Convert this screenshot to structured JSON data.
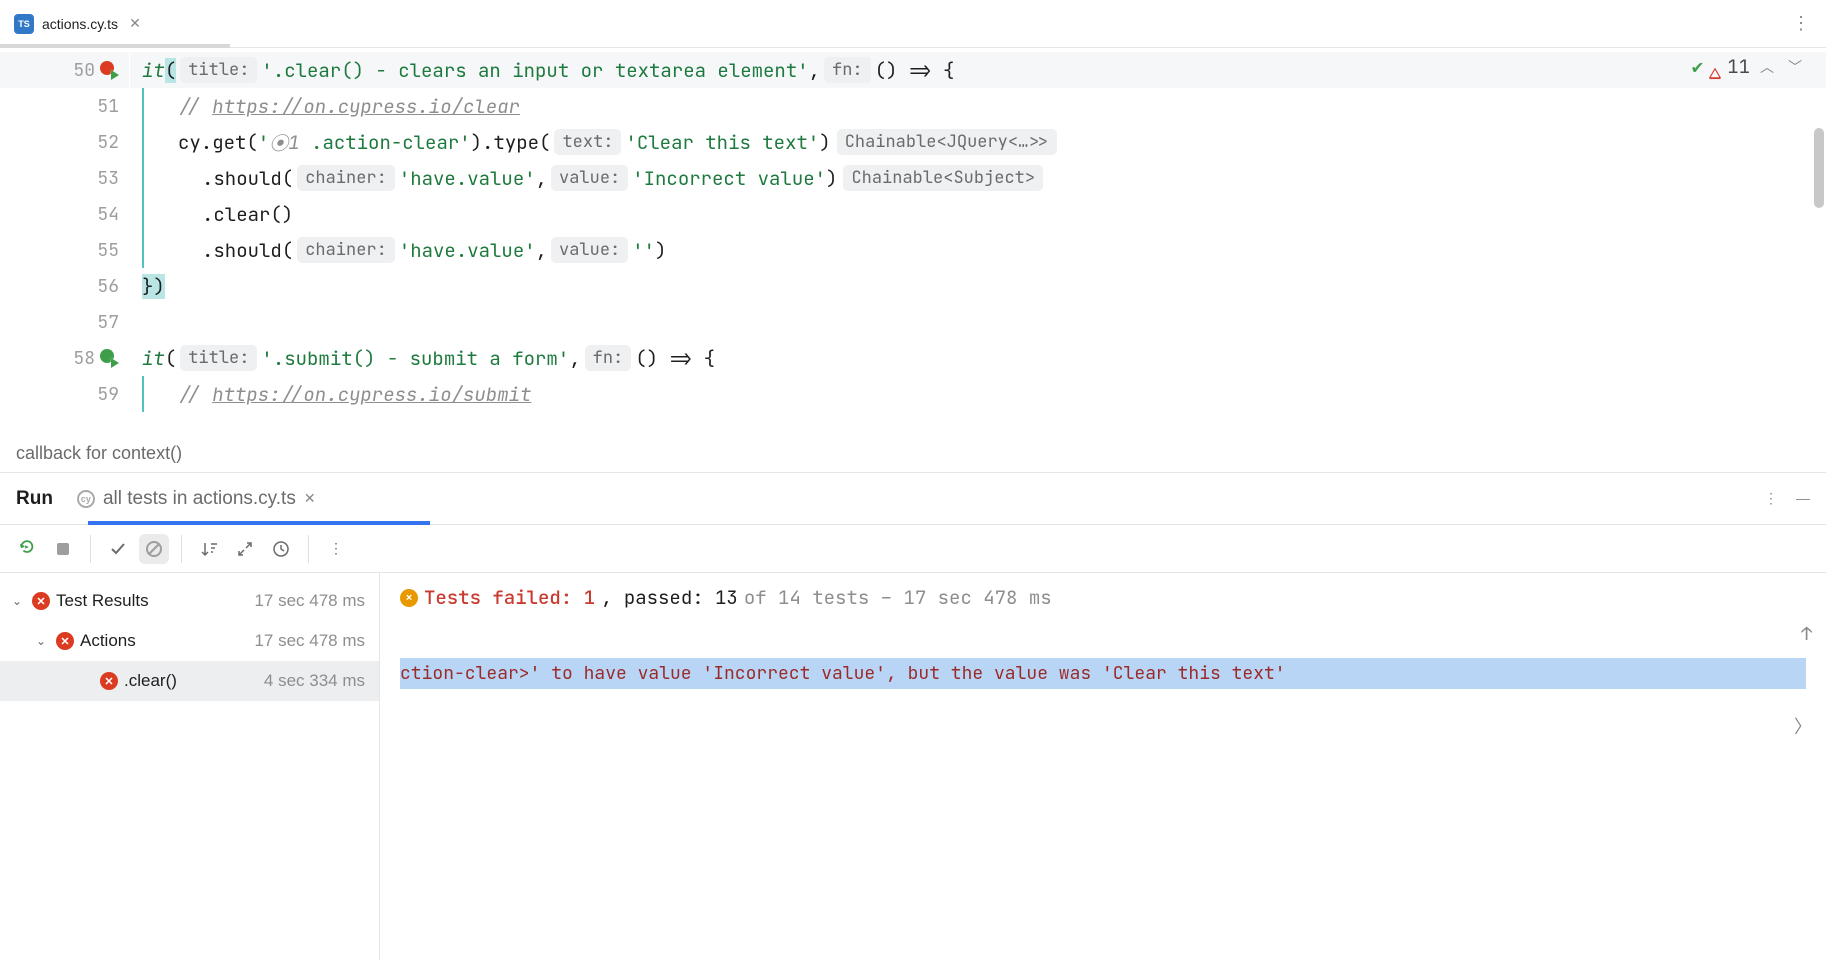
{
  "tab": {
    "filename": "actions.cy.ts"
  },
  "inspection": {
    "count": "11"
  },
  "code": {
    "line50": {
      "fn": "it",
      "title_hint": "title:",
      "title": "'.clear() - clears an input or textarea element'",
      "fn_hint": "fn:",
      "arrow": "() => {"
    },
    "line51": {
      "comment": "// ",
      "url": "https://on.cypress.io/clear"
    },
    "line52": {
      "pre": "cy.get(",
      "loc_icon": "⦿",
      "loc_num": "1",
      "sel": " .action-clear'",
      "mid": ").type(",
      "text_hint": "text:",
      "text": "'Clear this text'",
      "end": ")",
      "type_hint": "Chainable<JQuery<…>>"
    },
    "line53": {
      "pre": ".should(",
      "ch_hint": "chainer:",
      "ch": "'have.value'",
      "c": ",",
      "val_hint": "value:",
      "val": "'Incorrect value'",
      "end": ")",
      "type_hint": "Chainable<Subject>"
    },
    "line54": {
      "text": ".clear()"
    },
    "line55": {
      "pre": ".should(",
      "ch_hint": "chainer:",
      "ch": "'have.value'",
      "c": ",",
      "val_hint": "value:",
      "val": "''",
      "end": ")"
    },
    "line56": {
      "close": "})"
    },
    "line58": {
      "fn": "it",
      "title_hint": "title:",
      "title": "'.submit() - submit a form'",
      "fn_hint": "fn:",
      "arrow": "() => {"
    },
    "line59": {
      "comment": "// ",
      "url": "https://on.cypress.io/submit"
    }
  },
  "lines": [
    "50",
    "51",
    "52",
    "53",
    "54",
    "55",
    "56",
    "57",
    "58",
    "59"
  ],
  "breadcrumb": "callback for context()",
  "run": {
    "tab1": "Run",
    "tab2": "all tests in actions.cy.ts"
  },
  "summary": {
    "failed_label": "Tests failed: ",
    "failed_n": "1",
    "passed_label": ", passed: ",
    "passed_n": "13",
    "of": " of 14 tests – 17 sec 478 ms"
  },
  "tree": {
    "root": {
      "label": "Test Results",
      "time": "17 sec 478 ms"
    },
    "actions": {
      "label": "Actions",
      "time": "17 sec 478 ms"
    },
    "clear": {
      "label": ".clear()",
      "time": "4 sec 334 ms"
    }
  },
  "output": "ction-clear>' to have value 'Incorrect value', but the value was 'Clear this text'"
}
